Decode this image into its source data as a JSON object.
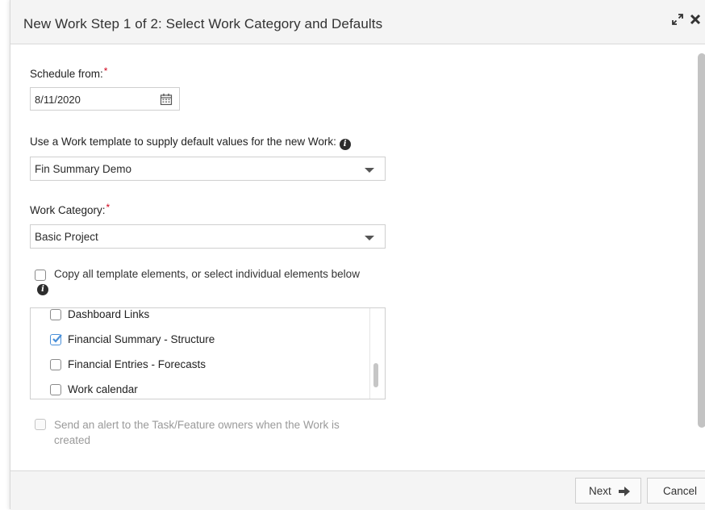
{
  "dialog": {
    "title": "New Work Step 1 of 2: Select Work Category and Defaults",
    "icons": {
      "expand": "expand-icon",
      "close": "close-icon"
    }
  },
  "schedule": {
    "label": "Schedule from:",
    "required_mark": "*",
    "date_value": "8/11/2020",
    "icon": "calendar-icon"
  },
  "template": {
    "label": "Use a Work template to supply default values for the new Work:",
    "selected": "Fin Summary Demo",
    "icon": "info-icon"
  },
  "category": {
    "label": "Work Category:",
    "required_mark": "*",
    "selected": "Basic Project"
  },
  "copy_all": {
    "label": "Copy all template elements, or select individual elements below",
    "checked": false
  },
  "elements": [
    {
      "label": "Dashboard Links",
      "checked": false
    },
    {
      "label": "Financial Summary - Structure",
      "checked": true
    },
    {
      "label": "Financial Entries - Forecasts",
      "checked": false
    },
    {
      "label": "Work calendar",
      "checked": false
    }
  ],
  "alert": {
    "label": "Send an alert to the Task/Feature owners when the Work is created",
    "checked": false,
    "disabled": true
  },
  "footer": {
    "next_label": "Next",
    "cancel_label": "Cancel"
  },
  "colors": {
    "accent": "#4a90d9",
    "required": "#d0021b",
    "header_bg": "#f4f4f4"
  }
}
